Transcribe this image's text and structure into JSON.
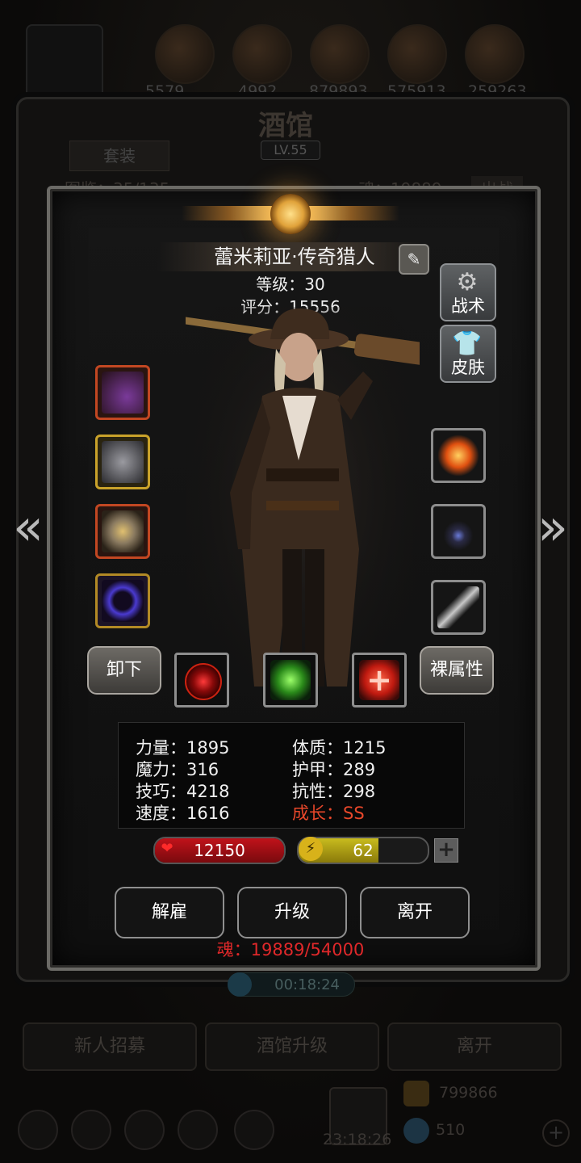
{
  "background": {
    "resources": [
      "5579",
      "4992",
      "879893",
      "575913",
      "259263"
    ],
    "screen_title": "酒馆",
    "level": "LV.55",
    "set_tab": "套装",
    "row_left": "图鉴：35/135",
    "row_right": "魂：19889",
    "row_button": "出战",
    "buttons": [
      "新人招募",
      "酒馆升级",
      "离开"
    ],
    "timer": "00:18:24",
    "gold": "799866",
    "gems": "510",
    "clock": "23:18:26"
  },
  "hero": {
    "name": "蕾米莉亚·传奇猎人",
    "level_line": "等级：30",
    "score_line": "评分：15556"
  },
  "side_buttons": {
    "tactics": "战术",
    "skin": "皮肤"
  },
  "equipment_left": [
    "pistol",
    "chest-armor",
    "ring",
    "bracelet"
  ],
  "equipment_right": [
    "fire-orb",
    "necklace",
    "dagger"
  ],
  "actions": {
    "unequip": "卸下",
    "naked_stats": "裸属性"
  },
  "skills": [
    "red-target-skill",
    "green-skull-skill",
    "red-cross-skill"
  ],
  "stats": {
    "strength": "力量：1895",
    "constitution": "体质：1215",
    "magic": "魔力：316",
    "armor": "护甲：289",
    "skill": "技巧：4218",
    "resistance": "抗性：298",
    "speed": "速度：1616",
    "growth": "成长：SS"
  },
  "hp": {
    "value": "12150",
    "fill": 1.0,
    "color": "#c0121a"
  },
  "energy": {
    "value": "62",
    "fill": 0.62,
    "color": "#c8bb1e"
  },
  "buttons": {
    "dismiss": "解雇",
    "upgrade": "升级",
    "leave": "离开"
  },
  "soul": "魂：19889/54000"
}
